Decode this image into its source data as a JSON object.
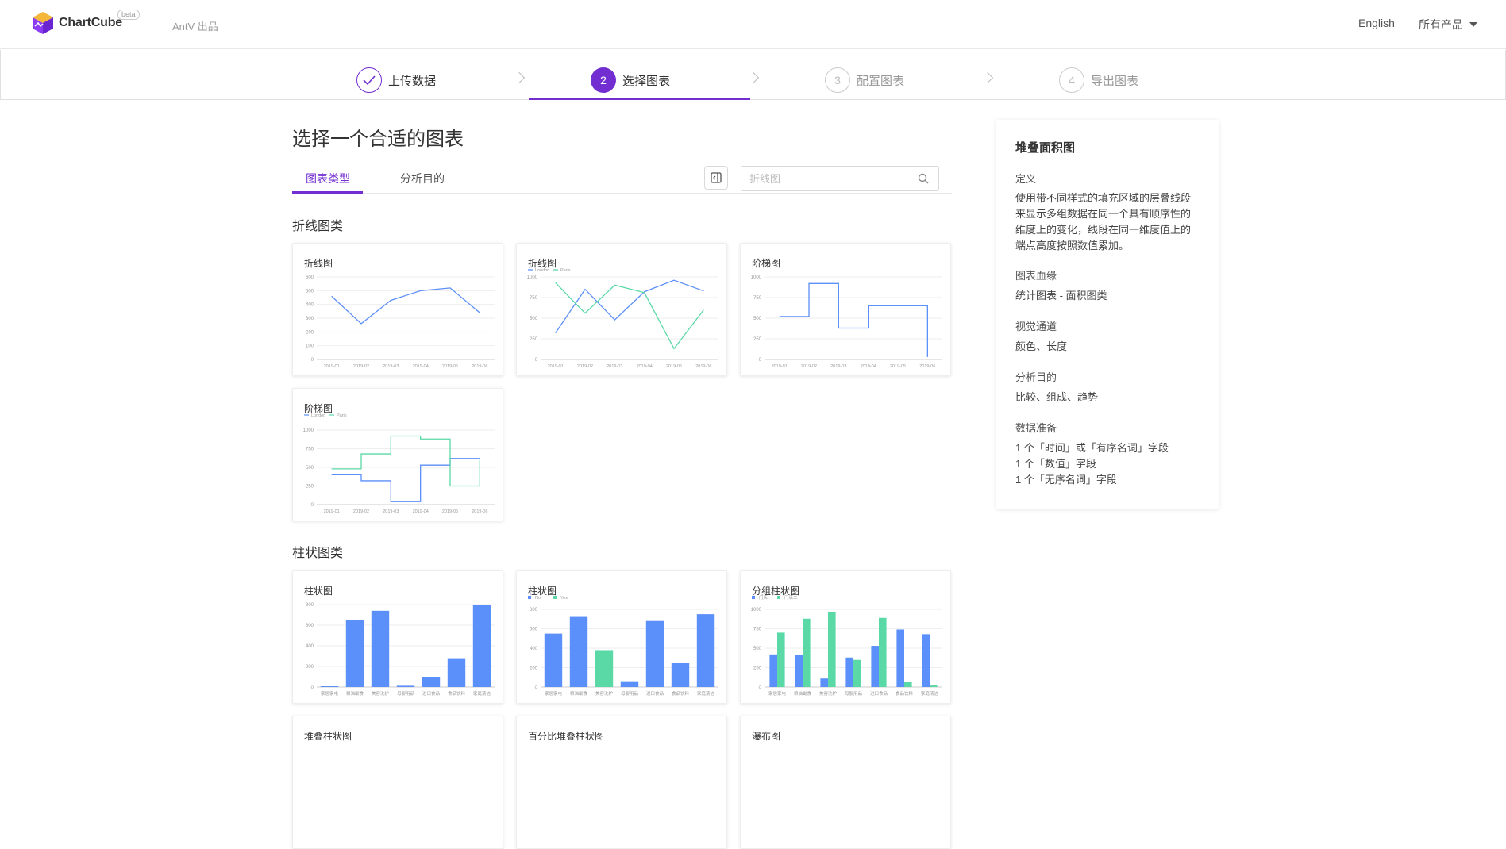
{
  "header": {
    "brand": "ChartCube",
    "beta": "beta",
    "antv": "AntV 出品",
    "lang": "English",
    "products": "所有产品"
  },
  "steps": [
    {
      "num": "",
      "label": "上传数据",
      "state": "done"
    },
    {
      "num": "2",
      "label": "选择图表",
      "state": "active"
    },
    {
      "num": "3",
      "label": "配置图表",
      "state": "todo"
    },
    {
      "num": "4",
      "label": "导出图表",
      "state": "todo"
    }
  ],
  "main": {
    "title": "选择一个合适的图表",
    "tabs": [
      "图表类型",
      "分析目的"
    ],
    "search_placeholder": "折线图",
    "sections": [
      "折线图类",
      "柱状图类"
    ]
  },
  "cards": [
    {
      "title": "折线图"
    },
    {
      "title": "折线图"
    },
    {
      "title": "阶梯图"
    },
    {
      "title": "阶梯图"
    },
    {
      "title": "柱状图"
    },
    {
      "title": "柱状图"
    },
    {
      "title": "分组柱状图"
    },
    {
      "title": "堆叠柱状图"
    },
    {
      "title": "百分比堆叠柱状图"
    },
    {
      "title": "瀑布图"
    }
  ],
  "colors": {
    "accent": "#722ed1",
    "blue": "#5b8ff9",
    "green": "#5ad8a6"
  },
  "mini": {
    "months": [
      "2019-01",
      "2019-02",
      "2019-03",
      "2019-04",
      "2019-05",
      "2019-06"
    ],
    "categories": [
      "家居家电",
      "粮油副食",
      "美容洗护",
      "母婴用品",
      "进口食品",
      "食品饮料",
      "家庭清洁"
    ],
    "legend_lp": [
      "London",
      "Paris"
    ],
    "legend_ny": [
      "No",
      "Yes"
    ],
    "legend_store": [
      "门店一",
      "门店二"
    ]
  },
  "chart_data": [
    {
      "type": "line",
      "x": [
        "2019-01",
        "2019-02",
        "2019-03",
        "2019-04",
        "2019-05",
        "2019-06"
      ],
      "series": [
        {
          "values": [
            460,
            260,
            430,
            500,
            520,
            340
          ]
        }
      ],
      "ylim": [
        0,
        600
      ]
    },
    {
      "type": "line",
      "x": [
        "2019-01",
        "2019-02",
        "2019-03",
        "2019-04",
        "2019-05",
        "2019-06"
      ],
      "series": [
        {
          "name": "London",
          "values": [
            320,
            850,
            480,
            820,
            960,
            830
          ]
        },
        {
          "name": "Paris",
          "values": [
            930,
            560,
            900,
            810,
            130,
            600
          ]
        }
      ],
      "ylim": [
        0,
        1000
      ]
    },
    {
      "type": "line",
      "x": [
        "2019-01",
        "2019-02",
        "2019-03",
        "2019-04",
        "2019-05",
        "2019-06"
      ],
      "series": [
        {
          "values": [
            520,
            920,
            380,
            650,
            650,
            30
          ]
        }
      ],
      "ylim": [
        0,
        1000
      ]
    },
    {
      "type": "line",
      "x": [
        "2019-01",
        "2019-02",
        "2019-03",
        "2019-04",
        "2019-05",
        "2019-06"
      ],
      "series": [
        {
          "name": "London",
          "values": [
            400,
            320,
            40,
            530,
            620,
            620
          ]
        },
        {
          "name": "Paris",
          "values": [
            480,
            680,
            920,
            880,
            250,
            600
          ]
        }
      ],
      "ylim": [
        0,
        1000
      ]
    },
    {
      "type": "bar",
      "categories": [
        "家居家电",
        "粮油副食",
        "美容洗护",
        "母婴用品",
        "进口食品",
        "食品饮料",
        "家庭清洁"
      ],
      "values": [
        10,
        650,
        740,
        20,
        100,
        280,
        800
      ],
      "ylim": [
        0,
        800
      ]
    },
    {
      "type": "bar",
      "categories": [
        "家居家电",
        "粮油副食",
        "美容洗护",
        "母婴用品",
        "进口食品",
        "食品饮料",
        "家庭清洁"
      ],
      "series": [
        {
          "name": "No",
          "values": [
            550,
            730,
            null,
            60,
            680,
            250,
            750
          ]
        },
        {
          "name": "Yes",
          "values": [
            null,
            null,
            380,
            null,
            null,
            null,
            null
          ]
        }
      ],
      "ylim": [
        0,
        800
      ]
    },
    {
      "type": "bar",
      "categories": [
        "家居家电",
        "粮油副食",
        "美容洗护",
        "母婴用品",
        "进口食品",
        "食品饮料",
        "家庭清洁"
      ],
      "series": [
        {
          "name": "门店一",
          "values": [
            420,
            410,
            110,
            380,
            530,
            740,
            680
          ]
        },
        {
          "name": "门店二",
          "values": [
            700,
            880,
            970,
            350,
            890,
            70,
            30
          ]
        }
      ],
      "ylim": [
        0,
        1000
      ]
    }
  ],
  "detail": {
    "title": "堆叠面积图",
    "definition_label": "定义",
    "definition": "使用带不同样式的填充区域的层叠线段来显示多组数据在同一个具有顺序性的维度上的变化，线段在同一维度值上的端点高度按照数值累加。",
    "lineage_label": "图表血缘",
    "lineage": "统计图表 - 面积图类",
    "channel_label": "视觉通道",
    "channel": "颜色、长度",
    "purpose_label": "分析目的",
    "purpose": "比较、组成、趋势",
    "prep_label": "数据准备",
    "prep": [
      "1 个「时间」或「有序名词」字段",
      "1 个「数值」字段",
      "1 个「无序名词」字段"
    ]
  }
}
